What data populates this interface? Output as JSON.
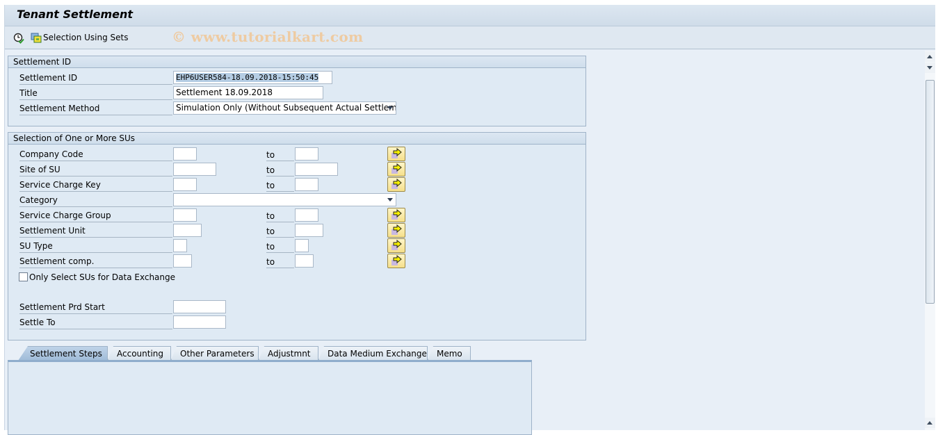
{
  "window": {
    "title": "Tenant Settlement"
  },
  "toolbar": {
    "execute_icon": "execute-clock-icon",
    "selection_sets_icon": "selection-sets-icon",
    "selection_sets_label": "Selection Using Sets",
    "watermark": "© www.tutorialkart.com"
  },
  "settlement_id_group": {
    "header": "Settlement ID",
    "fields": [
      {
        "label": "Settlement ID",
        "value": "EHP6USER584-18.09.2018-15:50:45"
      },
      {
        "label": "Title",
        "value": "Settlement 18.09.2018"
      },
      {
        "label": "Settlement Method",
        "value": "Simulation Only (Without Subsequent Actual Settlem…"
      }
    ]
  },
  "selection_group": {
    "header": "Selection of One or More SUs",
    "to_label": "to",
    "ranges": [
      {
        "label": "Company Code",
        "from": "",
        "to": ""
      },
      {
        "label": "Site of SU",
        "from": "",
        "to": ""
      },
      {
        "label": "Service Charge Key",
        "from": "",
        "to": ""
      },
      {
        "label": "Category",
        "value": ""
      },
      {
        "label": "Service Charge Group",
        "from": "",
        "to": ""
      },
      {
        "label": "Settlement Unit",
        "from": "",
        "to": ""
      },
      {
        "label": "SU Type",
        "from": "",
        "to": ""
      },
      {
        "label": "Settlement comp.",
        "from": "",
        "to": ""
      }
    ],
    "checkbox": {
      "label": "Only Select SUs for Data Exchange",
      "checked": false
    },
    "period": [
      {
        "label": "Settlement Prd Start",
        "value": ""
      },
      {
        "label": "Settle To",
        "value": ""
      }
    ]
  },
  "tabs": [
    {
      "label": "Settlement Steps",
      "active": true
    },
    {
      "label": "Accounting",
      "active": false
    },
    {
      "label": "Other Parameters",
      "active": false
    },
    {
      "label": "Adjustmnt",
      "active": false
    },
    {
      "label": "Data Medium Exchange",
      "active": false
    },
    {
      "label": "Memo",
      "active": false
    }
  ],
  "colors": {
    "background": "#e8eff7",
    "header_gradient": "#cfdce9",
    "multi_select_button": "#f5df8a",
    "watermark": "#f0c89a"
  }
}
